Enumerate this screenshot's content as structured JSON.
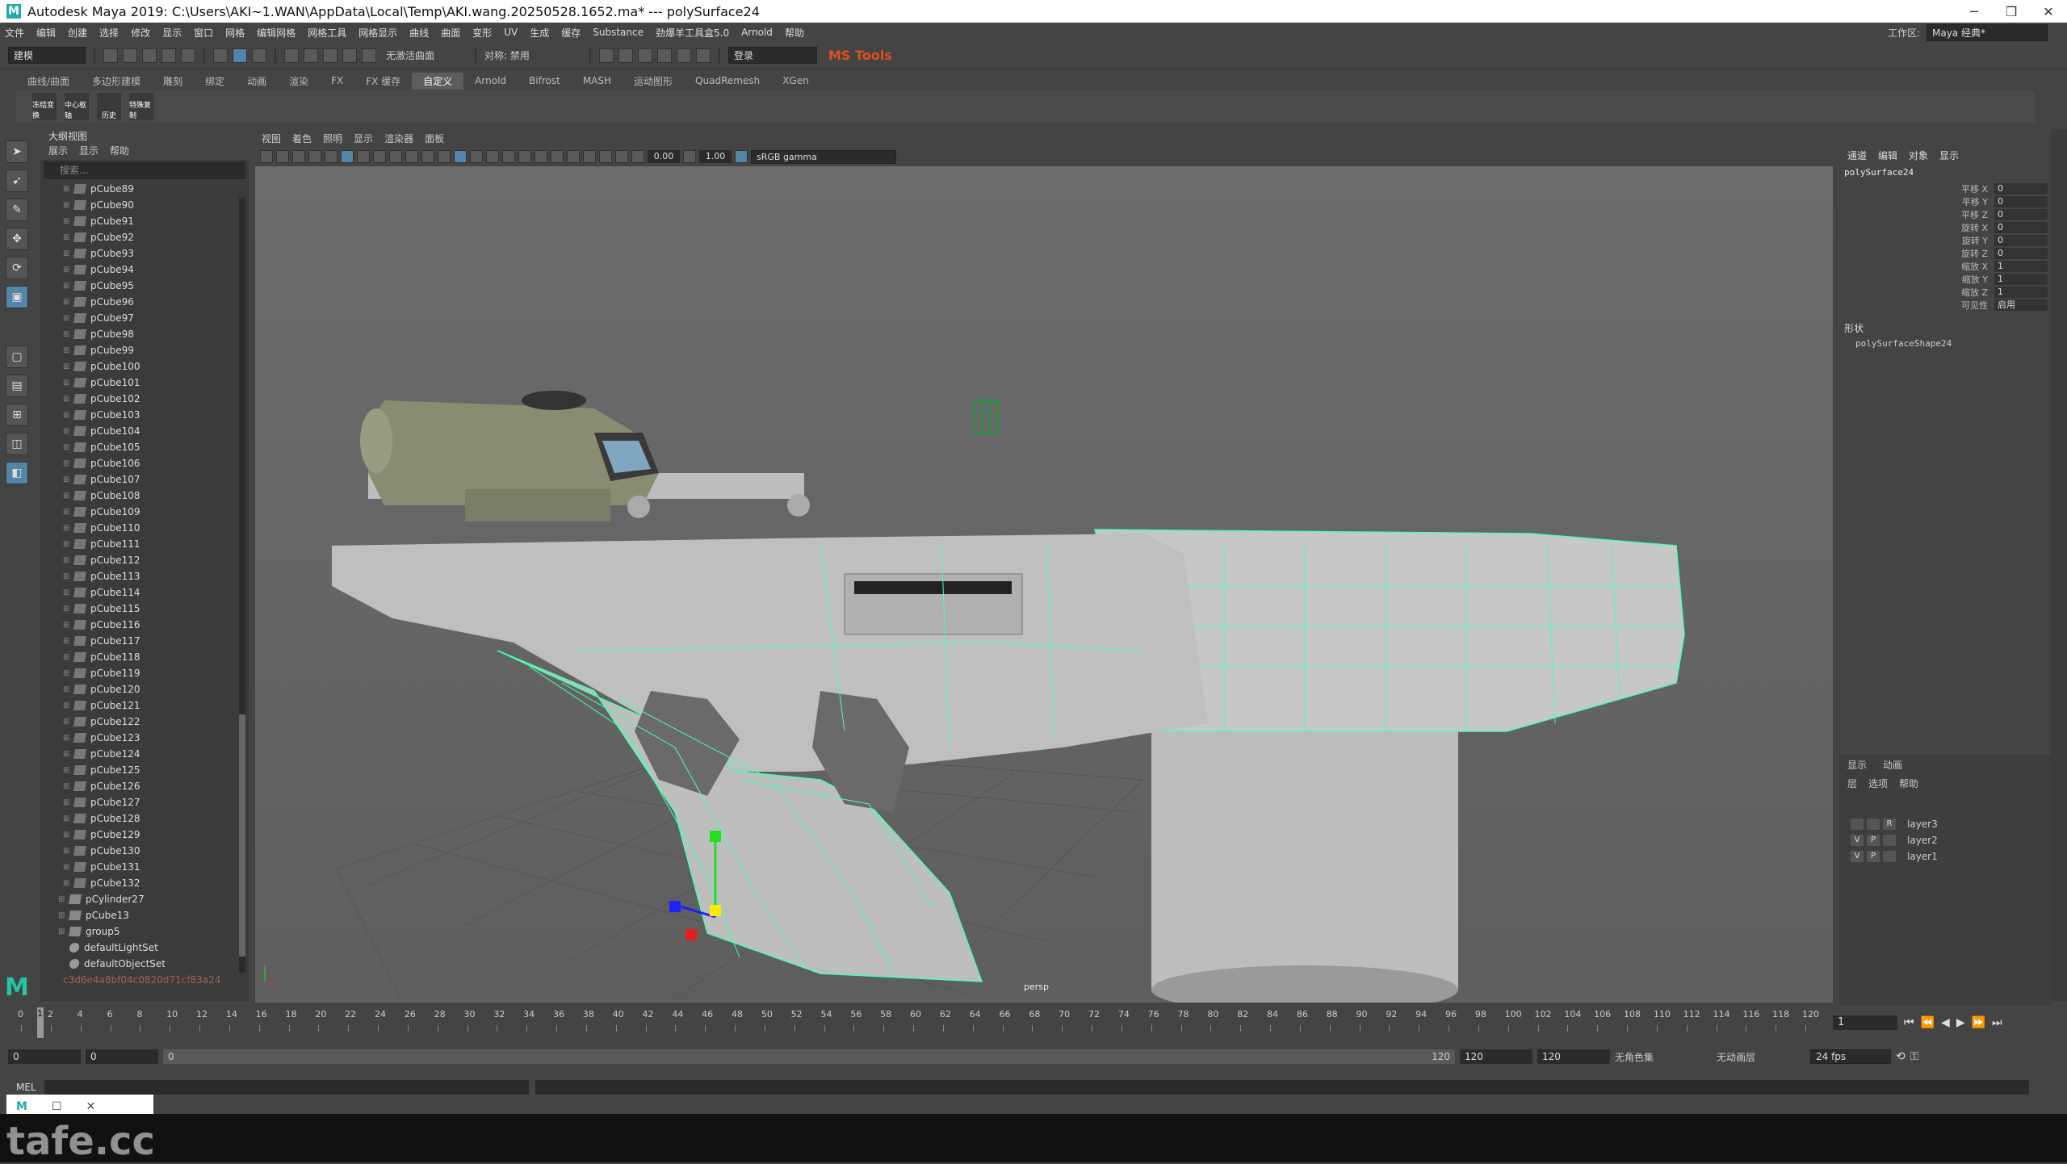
{
  "window": {
    "title": "Autodesk Maya 2019: C:\\Users\\AKI~1.WAN\\AppData\\Local\\Temp\\AKI.wang.20250528.1652.ma*   ---   polySurface24",
    "min": "─",
    "max": "❐",
    "close": "✕"
  },
  "menubar": {
    "items": [
      "文件",
      "编辑",
      "创建",
      "选择",
      "修改",
      "显示",
      "窗口",
      "网格",
      "编辑网格",
      "网格工具",
      "网格显示",
      "曲线",
      "曲面",
      "变形",
      "UV",
      "生成",
      "缓存",
      "Substance",
      "劲爆羊工具盒5.0",
      "Arnold",
      "帮助"
    ],
    "workspace_label": "工作区:",
    "workspace_value": "Maya 经典*"
  },
  "statusline": {
    "mode": "建模",
    "symmetry": "对称: 禁用",
    "live_surface": "无激活曲面",
    "login": "登录",
    "plugin_logo": "MS Tools"
  },
  "shelf": {
    "tabs": [
      "曲线/曲面",
      "多边形建模",
      "雕刻",
      "绑定",
      "动画",
      "渲染",
      "FX",
      "FX 缓存",
      "自定义",
      "Arnold",
      "Bifrost",
      "MASH",
      "运动图形",
      "QuadRemesh",
      "XGen"
    ],
    "active_tab": "自定义",
    "buttons": [
      "冻结变换",
      "中心枢轴",
      "历史",
      "特殊复制"
    ]
  },
  "outliner": {
    "title": "大纲视图",
    "menus": [
      "展示",
      "显示",
      "帮助"
    ],
    "search_placeholder": "搜索...",
    "items": [
      "pCube89",
      "pCube90",
      "pCube91",
      "pCube92",
      "pCube93",
      "pCube94",
      "pCube95",
      "pCube96",
      "pCube97",
      "pCube98",
      "pCube99",
      "pCube100",
      "pCube101",
      "pCube102",
      "pCube103",
      "pCube104",
      "pCube105",
      "pCube106",
      "pCube107",
      "pCube108",
      "pCube109",
      "pCube110",
      "pCube111",
      "pCube112",
      "pCube113",
      "pCube114",
      "pCube115",
      "pCube116",
      "pCube117",
      "pCube118",
      "pCube119",
      "pCube120",
      "pCube121",
      "pCube122",
      "pCube123",
      "pCube124",
      "pCube125",
      "pCube126",
      "pCube127",
      "pCube128",
      "pCube129",
      "pCube130",
      "pCube131",
      "pCube132"
    ],
    "groups": [
      "pCylinder27",
      "pCube13",
      "group5"
    ],
    "sets": [
      "defaultLightSet",
      "defaultObjectSet"
    ],
    "last": "c3d6e4a8bf04c0820d71cf83a24"
  },
  "viewport": {
    "menus": [
      "视图",
      "着色",
      "照明",
      "显示",
      "渲染器",
      "面板"
    ],
    "exposure": "0.00",
    "gamma": "1.00",
    "color_space": "sRGB gamma",
    "camera": "persp"
  },
  "channelbox": {
    "tabs": [
      "通道",
      "编辑",
      "对象",
      "显示"
    ],
    "object": "polySurface24",
    "attributes": [
      {
        "label": "平移 X",
        "value": "0"
      },
      {
        "label": "平移 Y",
        "value": "0"
      },
      {
        "label": "平移 Z",
        "value": "0"
      },
      {
        "label": "旋转 X",
        "value": "0"
      },
      {
        "label": "旋转 Y",
        "value": "0"
      },
      {
        "label": "旋转 Z",
        "value": "0"
      },
      {
        "label": "缩放 X",
        "value": "1"
      },
      {
        "label": "缩放 Y",
        "value": "1"
      },
      {
        "label": "缩放 Z",
        "value": "1"
      },
      {
        "label": "可见性",
        "value": "启用"
      }
    ],
    "shapes_label": "形状",
    "shape_name": "polySurfaceShape24"
  },
  "layers": {
    "tabs": [
      "显示",
      "动画"
    ],
    "menus": [
      "层",
      "选项",
      "帮助"
    ],
    "items": [
      {
        "v": "",
        "p": "",
        "r": "R",
        "name": "layer3"
      },
      {
        "v": "V",
        "p": "P",
        "r": "",
        "name": "layer2"
      },
      {
        "v": "V",
        "p": "P",
        "r": "",
        "name": "layer1"
      }
    ]
  },
  "timeline": {
    "ticks": [
      "0",
      "2",
      "4",
      "6",
      "8",
      "10",
      "12",
      "14",
      "16",
      "18",
      "20",
      "22",
      "24",
      "26",
      "28",
      "30",
      "32",
      "34",
      "36",
      "38",
      "40",
      "42",
      "44",
      "46",
      "48",
      "50",
      "52",
      "54",
      "56",
      "58",
      "60",
      "62",
      "64",
      "66",
      "68",
      "70",
      "72",
      "74",
      "76",
      "78",
      "80",
      "82",
      "84",
      "86",
      "88",
      "90",
      "92",
      "94",
      "96",
      "98",
      "100",
      "102",
      "104",
      "106",
      "108",
      "110",
      "112",
      "114",
      "116",
      "118",
      "120"
    ],
    "current_frame": "1",
    "current_field": "1"
  },
  "range": {
    "start": "0",
    "start2": "0",
    "slider_start": "0",
    "slider_end": "120",
    "end": "120",
    "end2": "120",
    "character_set": "无角色集",
    "anim_layer": "无动画层",
    "fps": "24 fps"
  },
  "cmdline": {
    "label": "MEL"
  },
  "watermark": "tafe.cc",
  "colors": {
    "accent": "#5285a6",
    "wire": "#4affb0",
    "model": "#bdbdbd",
    "scope": "#8a8c72"
  }
}
